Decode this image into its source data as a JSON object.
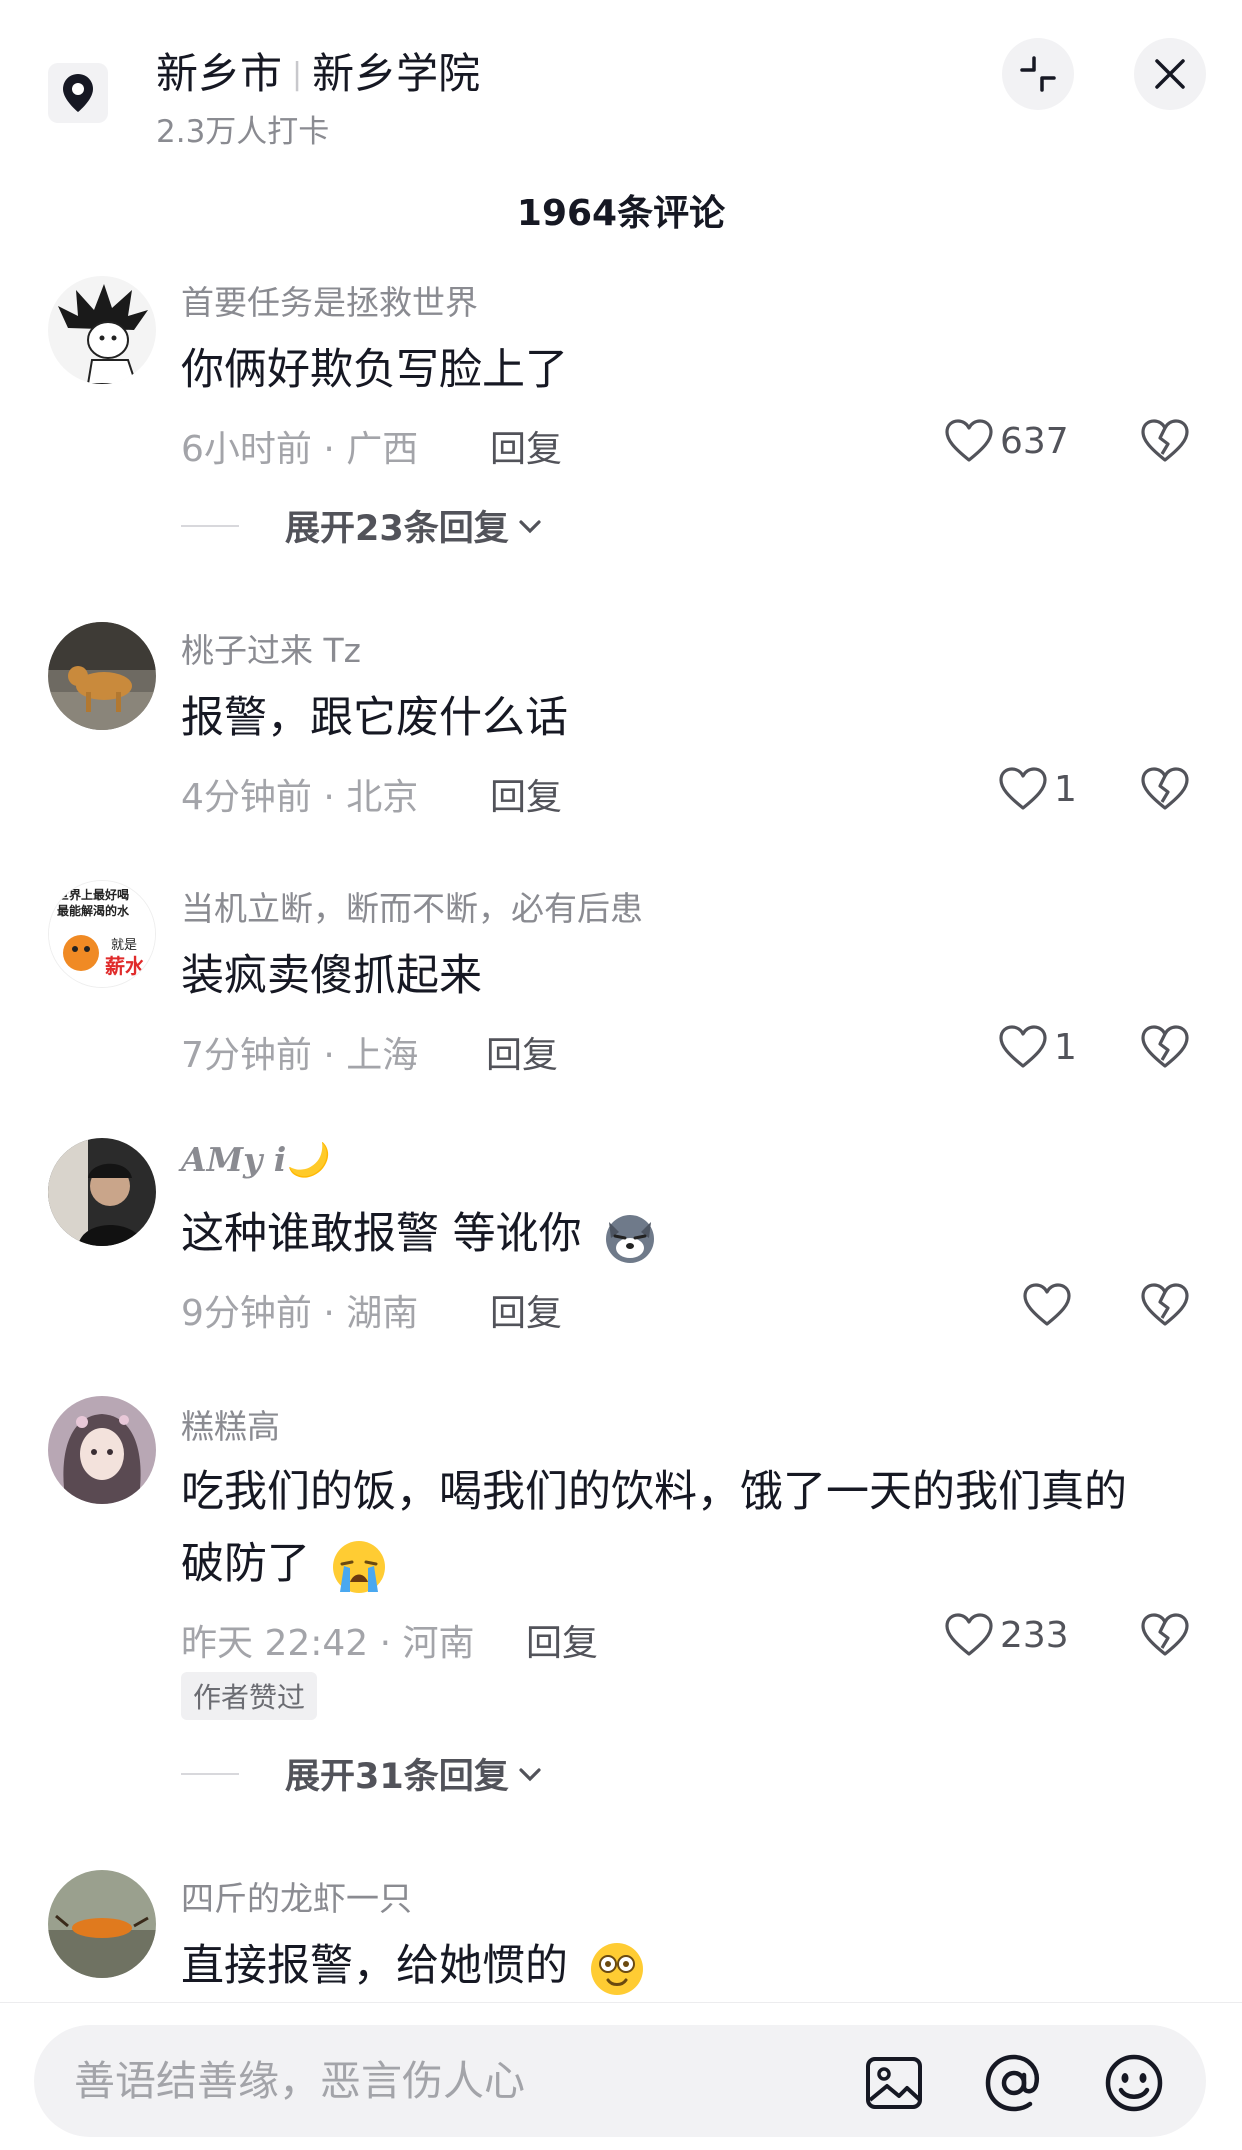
{
  "header": {
    "city": "新乡市",
    "place": "新乡学院",
    "checkins": "2.3万人打卡"
  },
  "comments_count": "1964条评论",
  "comments": [
    {
      "user": "首要任务是拯救世界",
      "text": "你俩好欺负写脸上了",
      "meta": "6小时前 · 广西",
      "reply": "回复",
      "likes": "637",
      "expand": "展开23条回复"
    },
    {
      "user": "桃子过来 Tz",
      "text": "报警，跟它废什么话",
      "meta": "4分钟前 · 北京",
      "reply": "回复",
      "likes": "1"
    },
    {
      "user": "当机立断，断而不断，必有后患",
      "text": "装疯卖傻抓起来",
      "meta": "7分钟前 · 上海",
      "reply": "回复",
      "likes": "1",
      "avatar_text": [
        "世界上最好喝",
        "最能解渴的水",
        "就是",
        "薪水"
      ]
    },
    {
      "user": "AMy i",
      "user_suffix": "🌙",
      "text": "这种谁敢报警 等讹你",
      "meta": "9分钟前 · 湖南",
      "reply": "回复",
      "likes": ""
    },
    {
      "user": "糕糕高",
      "text_line1": "吃我们的饭，喝我们的饮料，饿了一天的我们真的",
      "text_line2": "破防了",
      "meta": "昨天 22:42 · 河南",
      "reply": "回复",
      "likes": "233",
      "badge": "作者赞过",
      "expand": "展开31条回复"
    },
    {
      "user": "四斤的龙虾一只",
      "text": "直接报警，给她惯的"
    }
  ],
  "footer": {
    "placeholder": "善语结善缘，恶言伤人心"
  },
  "icons": {
    "location": "location-pin-icon",
    "collapse": "collapse-icon",
    "close": "close-icon",
    "like": "heart-icon",
    "dislike": "broken-heart-icon",
    "image": "image-icon",
    "mention": "at-icon",
    "emoji": "emoji-icon"
  },
  "colors": {
    "text_primary": "#161823",
    "text_secondary": "#8a8b91",
    "surface": "#f2f2f4"
  }
}
